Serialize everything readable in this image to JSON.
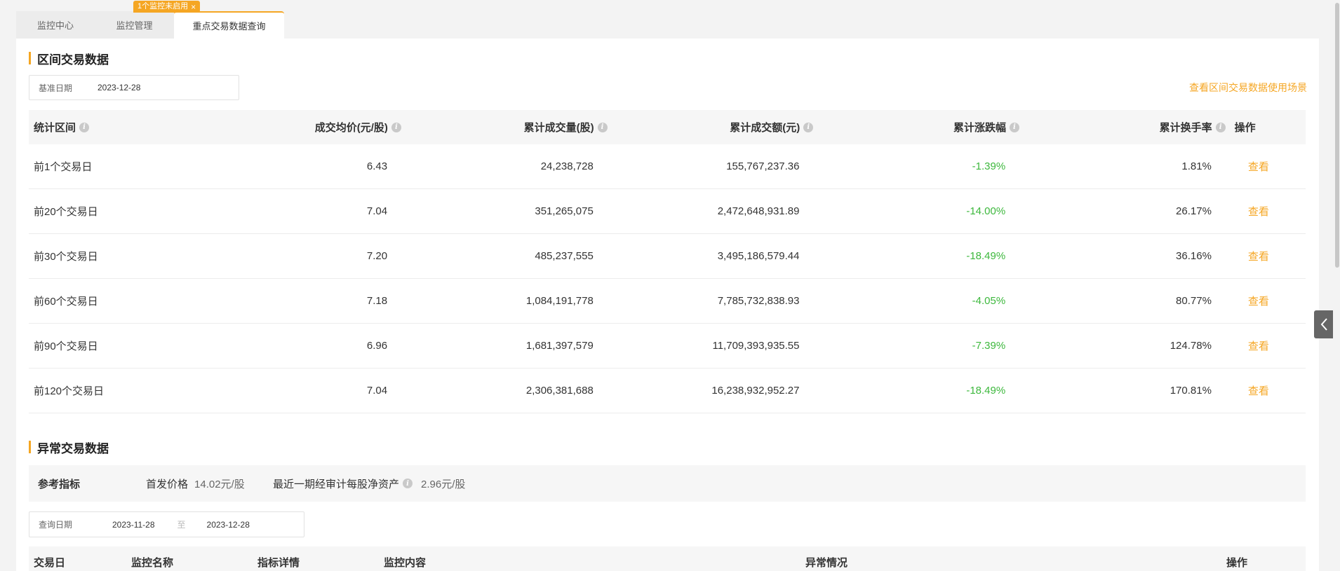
{
  "tabs": [
    {
      "label": "监控中心"
    },
    {
      "label": "监控管理"
    },
    {
      "label": "重点交易数据查询"
    }
  ],
  "tab_badge": {
    "text": "1个监控未启用",
    "close": "×"
  },
  "interval_section": {
    "title": "区间交易数据",
    "date_label": "基准日期",
    "date_value": "2023-12-28",
    "use_link": "查看区间交易数据使用场景",
    "columns": [
      "统计区间",
      "成交均价(元/股)",
      "累计成交量(股)",
      "累计成交额(元)",
      "累计涨跌幅",
      "累计换手率",
      "操作"
    ],
    "rows": [
      {
        "period": "前1个交易日",
        "avg_price": "6.43",
        "volume": "24,238,728",
        "amount": "155,767,237.36",
        "change": "-1.39%",
        "turnover": "1.81%",
        "op": "查看"
      },
      {
        "period": "前20个交易日",
        "avg_price": "7.04",
        "volume": "351,265,075",
        "amount": "2,472,648,931.89",
        "change": "-14.00%",
        "turnover": "26.17%",
        "op": "查看"
      },
      {
        "period": "前30个交易日",
        "avg_price": "7.20",
        "volume": "485,237,555",
        "amount": "3,495,186,579.44",
        "change": "-18.49%",
        "turnover": "36.16%",
        "op": "查看"
      },
      {
        "period": "前60个交易日",
        "avg_price": "7.18",
        "volume": "1,084,191,778",
        "amount": "7,785,732,838.93",
        "change": "-4.05%",
        "turnover": "80.77%",
        "op": "查看"
      },
      {
        "period": "前90个交易日",
        "avg_price": "6.96",
        "volume": "1,681,397,579",
        "amount": "11,709,393,935.55",
        "change": "-7.39%",
        "turnover": "124.78%",
        "op": "查看"
      },
      {
        "period": "前120个交易日",
        "avg_price": "7.04",
        "volume": "2,306,381,688",
        "amount": "16,238,932,952.27",
        "change": "-18.49%",
        "turnover": "170.81%",
        "op": "查看"
      }
    ]
  },
  "abnormal_section": {
    "title": "异常交易数据",
    "ref_label": "参考指标",
    "ipo_label": "首发价格",
    "ipo_value": "14.02元/股",
    "nav_label": "最近一期经审计每股净资产",
    "nav_value": "2.96元/股",
    "query_label": "查询日期",
    "date_from": "2023-11-28",
    "date_sep": "至",
    "date_to": "2023-12-28",
    "columns": [
      "交易日",
      "监控名称",
      "指标详情",
      "监控内容",
      "异常情况",
      "操作"
    ]
  },
  "colors": {
    "accent": "#f5a623",
    "negative": "#3db83d"
  },
  "icons": {
    "info": "info-icon",
    "close": "close-icon",
    "toggle": "chevron-left-icon"
  }
}
